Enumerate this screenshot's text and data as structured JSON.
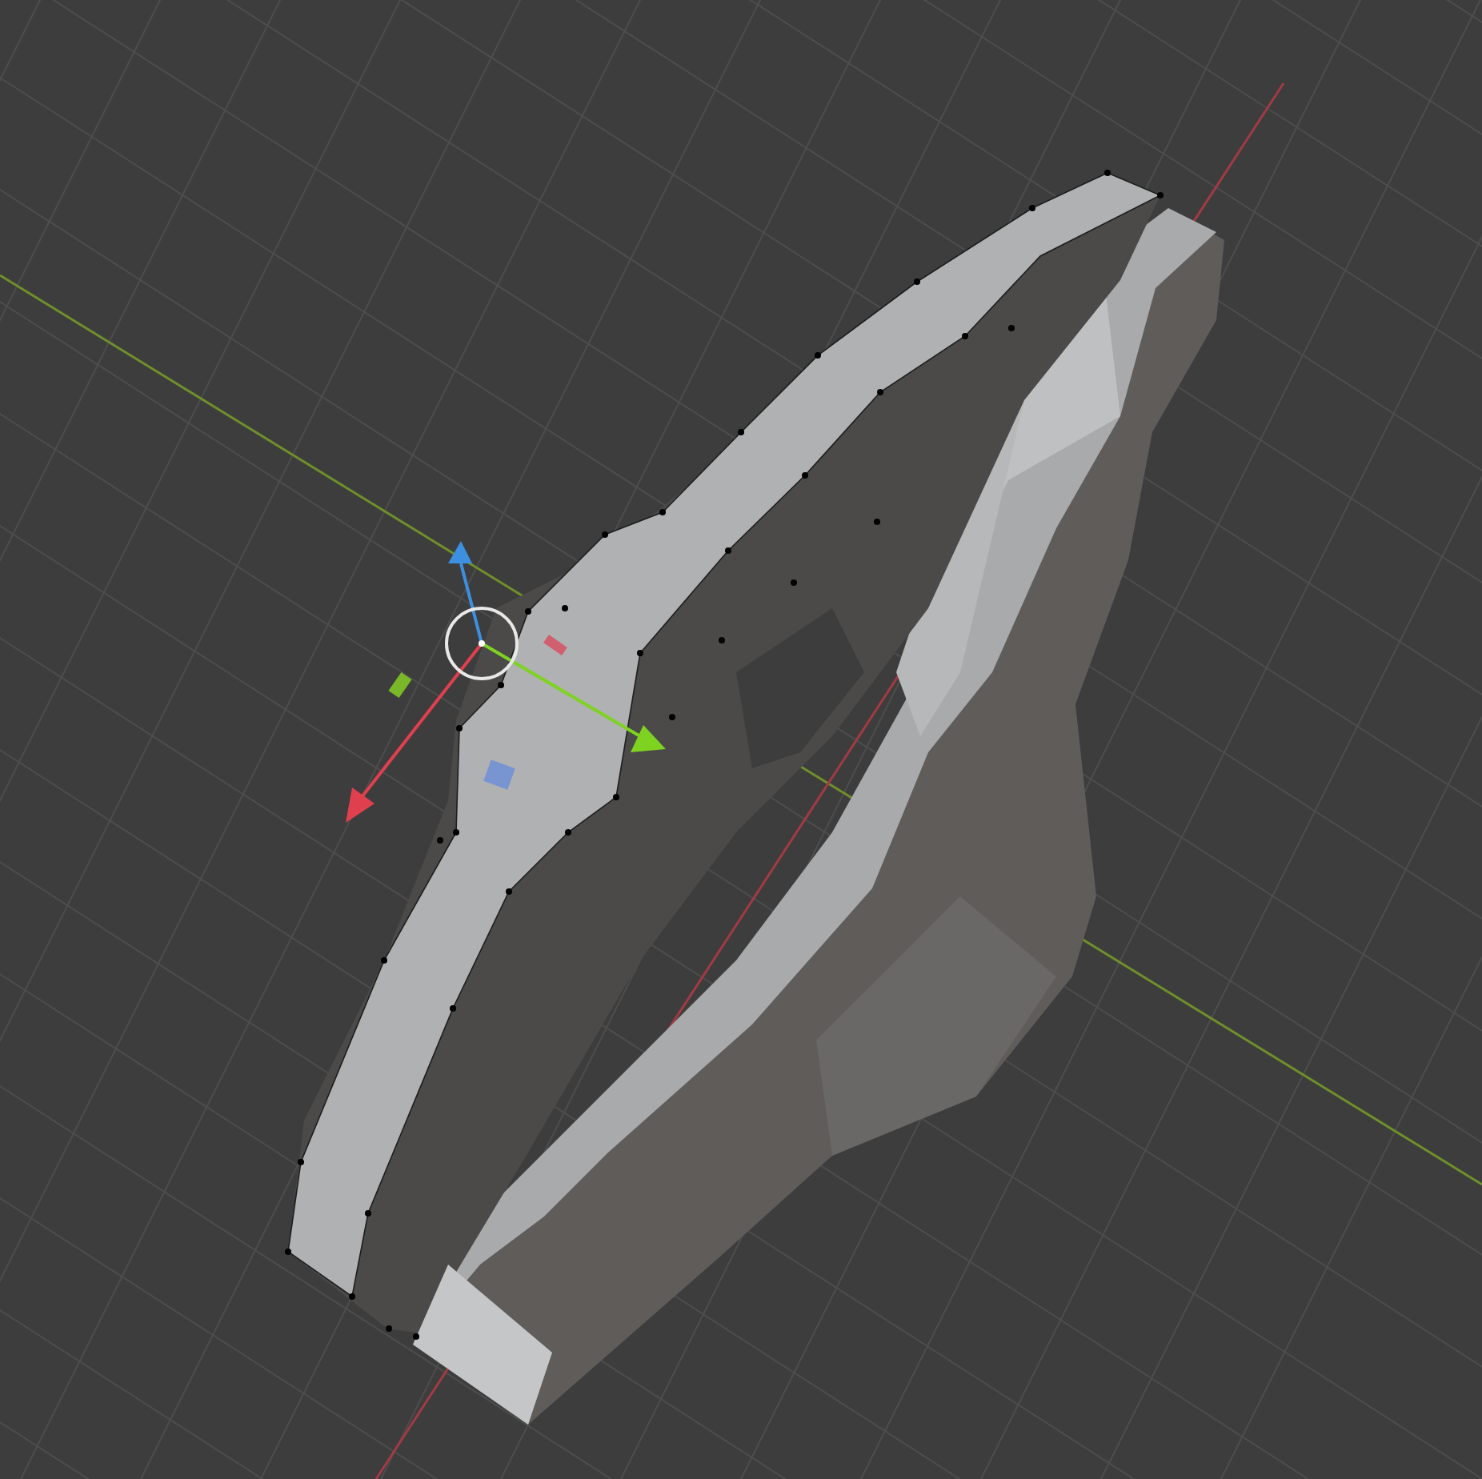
{
  "viewport": {
    "show_grid": true,
    "show_gizmo": true
  }
}
